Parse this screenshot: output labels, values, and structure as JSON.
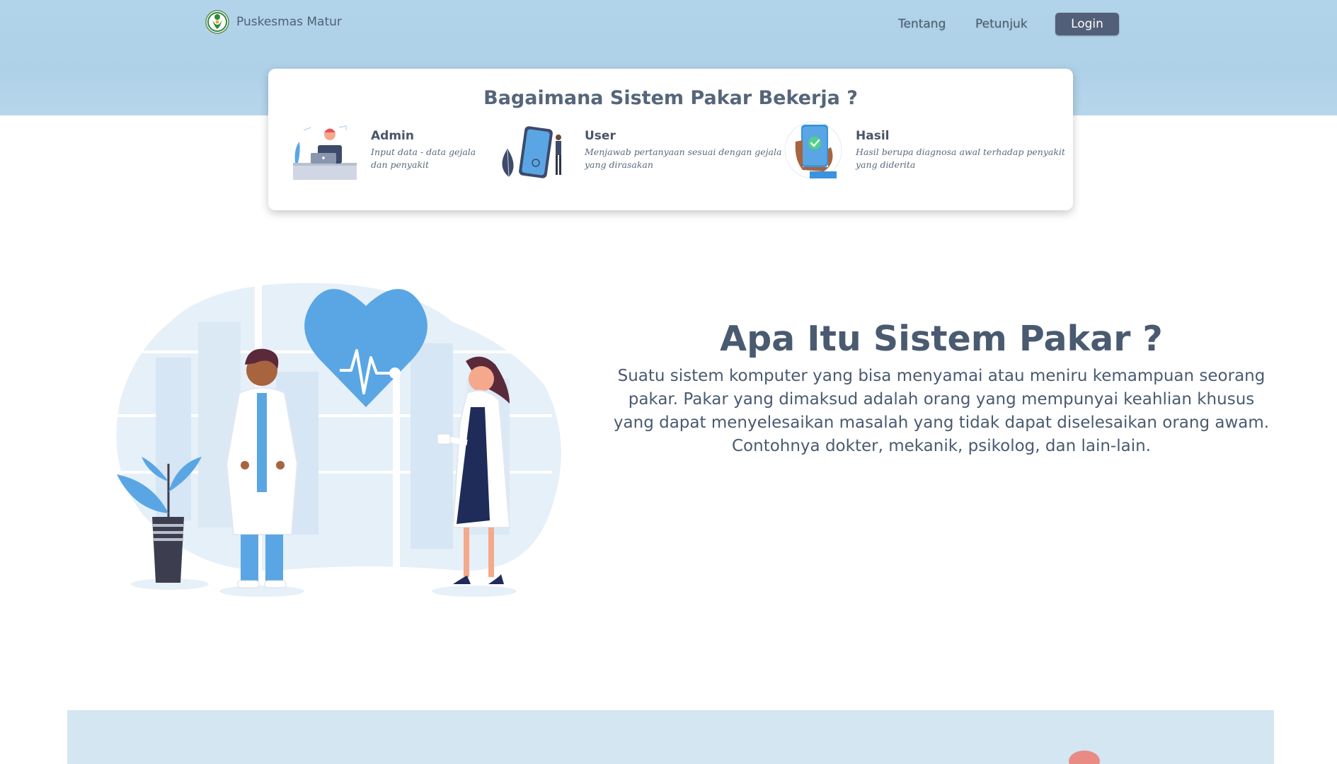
{
  "navbar": {
    "brand_name": "Puskesmas Matur",
    "links": [
      "Tentang",
      "Petunjuk"
    ],
    "login_label": "Login"
  },
  "how_it_works": {
    "title": "Bagaimana Sistem Pakar Bekerja ?",
    "steps": [
      {
        "name": "Admin",
        "description": "Input data - data gejala dan penyakit",
        "icon": "admin-laptop-illustration"
      },
      {
        "name": "User",
        "description": "Menjawab pertanyaan sesuai dengan gejala yang dirasakan",
        "icon": "user-phone-illustration"
      },
      {
        "name": "Hasil",
        "description": "Hasil berupa diagnosa awal terhadap penyakit yang diderita",
        "icon": "hasil-phone-check-illustration"
      }
    ]
  },
  "about": {
    "title": "Apa Itu Sistem Pakar ?",
    "text": "Suatu sistem komputer yang bisa menyamai atau meniru kemampuan seorang pakar. Pakar yang dimaksud adalah orang yang mempunyai keahlian khusus yang dapat menyelesaikan masalah yang tidak dapat diselesaikan orang awam. Contohnya dokter, mekanik, psikolog, dan lain-lain."
  },
  "colors": {
    "hero_band": "#b2d4ea",
    "login_button": "#525f78",
    "accent_blue": "#5aa6e4",
    "bottom_band": "#d3e6f2"
  }
}
